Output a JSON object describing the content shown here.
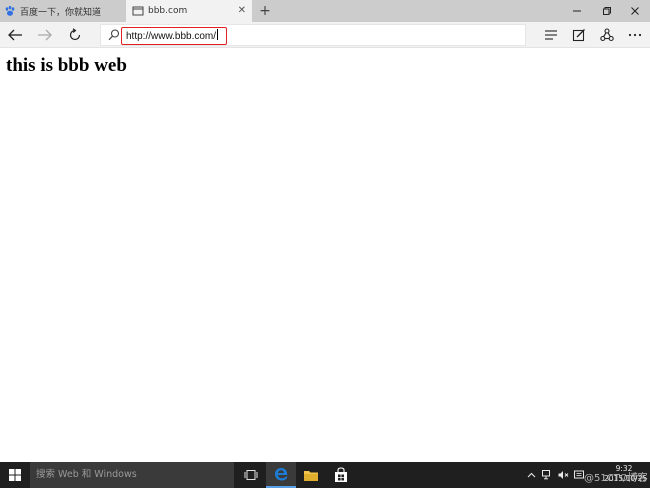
{
  "tabs": [
    {
      "title": "百度一下，你就知道",
      "active": false
    },
    {
      "title": "bbb.com",
      "active": true
    }
  ],
  "address_bar": {
    "url": "http://www.bbb.com/"
  },
  "page": {
    "heading": "this is bbb web"
  },
  "taskbar": {
    "search_placeholder": "搜索 Web 和 Windows",
    "time": "9:32",
    "date": "2015/10/25"
  },
  "watermark": "@51CTO博客",
  "colors": {
    "tab_strip": "#cccccc",
    "active_tab": "#f2f2f2",
    "address_highlight": "#e02020",
    "taskbar": "#1f1f1f",
    "edge_blue": "#1e7bd4"
  }
}
